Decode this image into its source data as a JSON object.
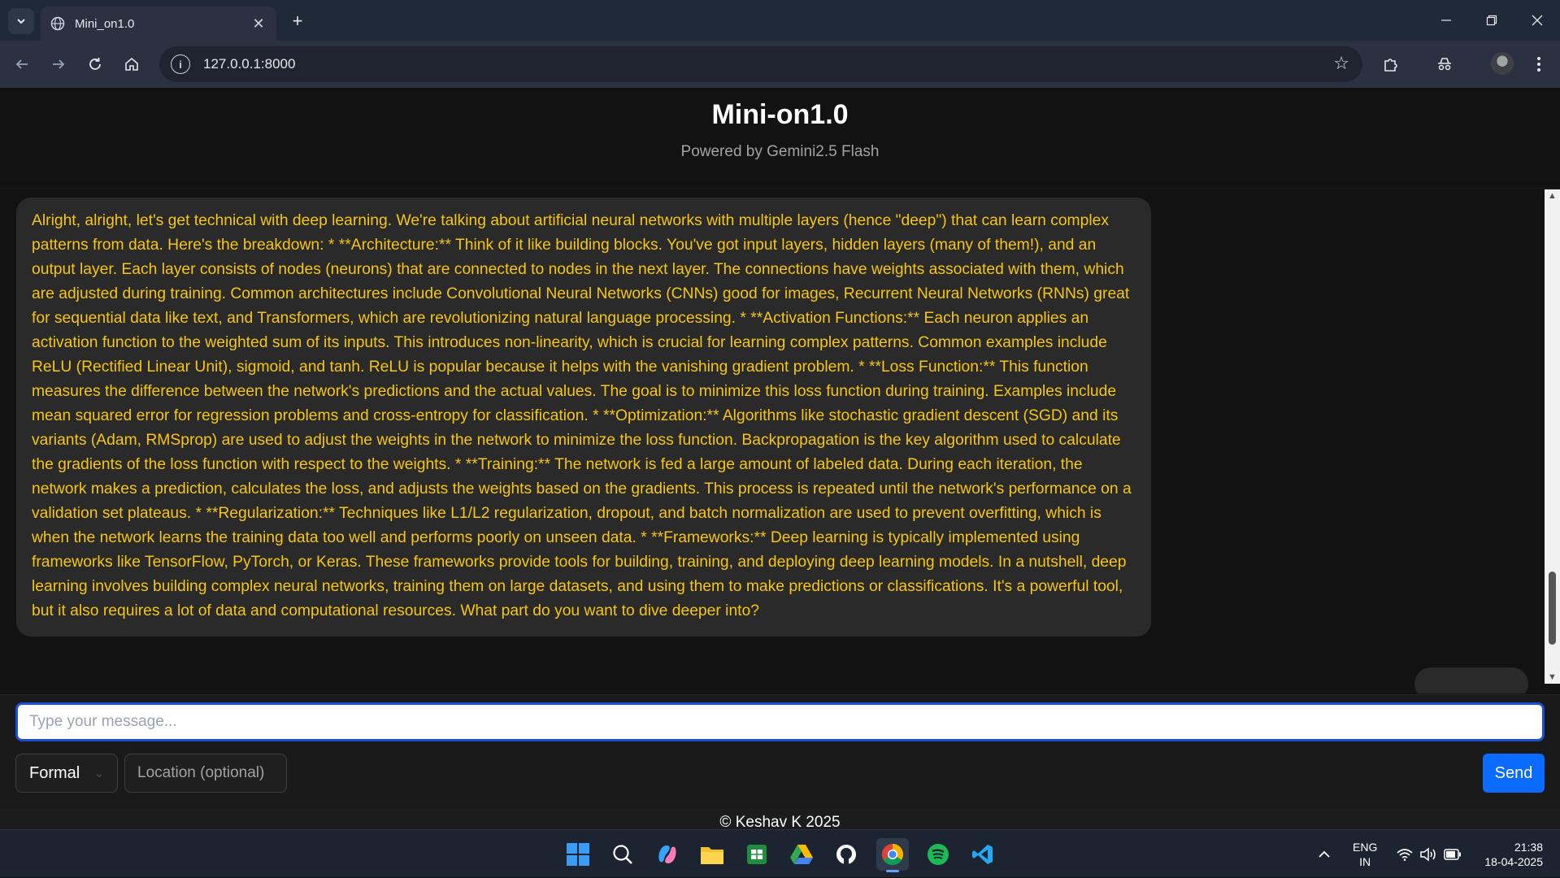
{
  "browser": {
    "tab_title": "Mini_on1.0",
    "url": "127.0.0.1:8000"
  },
  "header": {
    "title": "Mini-on1.0",
    "subtitle": "Powered by Gemini2.5 Flash"
  },
  "chat": {
    "messages": [
      {
        "role": "bot",
        "text": "Alright, alright, let's get technical with deep learning. We're talking about artificial neural networks with multiple layers (hence \"deep\") that can learn complex patterns from data. Here's the breakdown: * **Architecture:** Think of it like building blocks. You've got input layers, hidden layers (many of them!), and an output layer. Each layer consists of nodes (neurons) that are connected to nodes in the next layer. The connections have weights associated with them, which are adjusted during training. Common architectures include Convolutional Neural Networks (CNNs) good for images, Recurrent Neural Networks (RNNs) great for sequential data like text, and Transformers, which are revolutionizing natural language processing. * **Activation Functions:** Each neuron applies an activation function to the weighted sum of its inputs. This introduces non-linearity, which is crucial for learning complex patterns. Common examples include ReLU (Rectified Linear Unit), sigmoid, and tanh. ReLU is popular because it helps with the vanishing gradient problem. * **Loss Function:** This function measures the difference between the network's predictions and the actual values. The goal is to minimize this loss function during training. Examples include mean squared error for regression problems and cross-entropy for classification. * **Optimization:** Algorithms like stochastic gradient descent (SGD) and its variants (Adam, RMSprop) are used to adjust the weights in the network to minimize the loss function. Backpropagation is the key algorithm used to calculate the gradients of the loss function with respect to the weights. * **Training:** The network is fed a large amount of labeled data. During each iteration, the network makes a prediction, calculates the loss, and adjusts the weights based on the gradients. This process is repeated until the network's performance on a validation set plateaus. * **Regularization:** Techniques like L1/L2 regularization, dropout, and batch normalization are used to prevent overfitting, which is when the network learns the training data too well and performs poorly on unseen data. * **Frameworks:** Deep learning is typically implemented using frameworks like TensorFlow, PyTorch, or Keras. These frameworks provide tools for building, training, and deploying deep learning models. In a nutshell, deep learning involves building complex neural networks, training them on large datasets, and using them to make predictions or classifications. It's a powerful tool, but it also requires a lot of data and computational resources. What part do you want to dive deeper into?"
      }
    ]
  },
  "composer": {
    "message_placeholder": "Type your message...",
    "tone_selected": "Formal",
    "location_placeholder": "Location (optional)",
    "send_label": "Send"
  },
  "footer": {
    "text": "© Keshav K 2025"
  },
  "taskbar": {
    "language_line1": "ENG",
    "language_line2": "IN",
    "time": "21:38",
    "date": "18-04-2025",
    "apps": [
      "windows-start",
      "search",
      "copilot",
      "file-explorer",
      "sheets",
      "google-drive",
      "github",
      "chrome",
      "spotify",
      "vscode"
    ]
  },
  "colors": {
    "accent": "#0b6bff",
    "bot_text": "#f5c518",
    "bubble_bg": "#2a2a2a",
    "page_bg": "#121212"
  }
}
